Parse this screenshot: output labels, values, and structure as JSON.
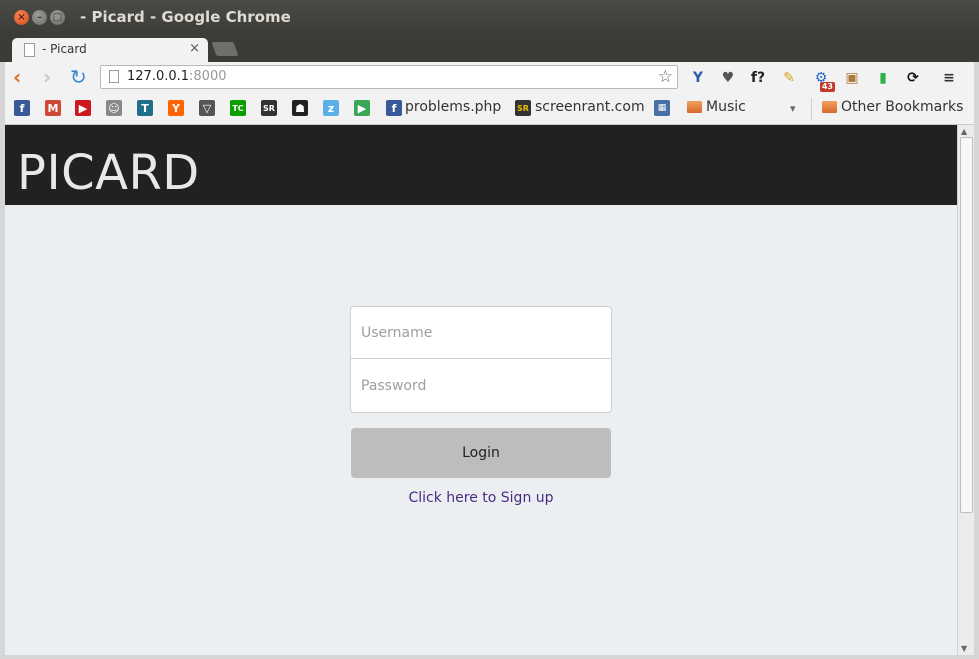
{
  "window": {
    "title": "- Picard - Google Chrome"
  },
  "tab": {
    "title": "- Picard",
    "close_glyph": "×"
  },
  "toolbar": {
    "url_host": "127.0.0.1",
    "url_port": ":8000",
    "star_glyph": "☆",
    "back_glyph": "‹",
    "forward_glyph": "›",
    "reload_glyph": "↻"
  },
  "extensions": [
    {
      "name": "vimium-icon",
      "glyph": "Y",
      "color": "#2b5fa8"
    },
    {
      "name": "pocket-icon",
      "glyph": "♥",
      "color": "#555555"
    },
    {
      "name": "font-finder-icon",
      "glyph": "f?",
      "color": "#222222"
    },
    {
      "name": "notes-icon",
      "glyph": "✎",
      "color": "#d6a21a"
    },
    {
      "name": "settings-gear-icon",
      "glyph": "⚙",
      "color": "#2867c7",
      "badge": "43"
    },
    {
      "name": "evernote-icon",
      "glyph": "▣",
      "color": "#b07a3a"
    },
    {
      "name": "feedly-icon",
      "glyph": "▮",
      "color": "#2bb24c"
    },
    {
      "name": "sync-icon",
      "glyph": "⟳",
      "color": "#111111"
    },
    {
      "name": "menu-icon",
      "glyph": "≡",
      "color": "#333333"
    }
  ],
  "bookmarks": {
    "icons": [
      {
        "name": "facebook-icon",
        "glyph": "f",
        "color": "#3b5998"
      },
      {
        "name": "gmail-icon",
        "glyph": "M",
        "color": "#d14836"
      },
      {
        "name": "youtube-icon",
        "glyph": "▶",
        "color": "#cc181e"
      },
      {
        "name": "reddit-icon",
        "glyph": "☺",
        "color": "#888888"
      },
      {
        "name": "t-icon",
        "glyph": "T",
        "color": "#1f6f8b"
      },
      {
        "name": "hacker-news-icon",
        "glyph": "Y",
        "color": "#ff6600"
      },
      {
        "name": "verge-icon",
        "glyph": "▽",
        "color": "#555555"
      },
      {
        "name": "techcrunch-icon",
        "glyph": "TC",
        "color": "#0a9e01"
      },
      {
        "name": "screenrant-small-icon",
        "glyph": "SR",
        "color": "#333333"
      },
      {
        "name": "robot-icon",
        "glyph": "☗",
        "color": "#222222"
      },
      {
        "name": "z-icon",
        "glyph": "z",
        "color": "#5bb0e8"
      },
      {
        "name": "play-store-icon",
        "glyph": "▶",
        "color": "#3aa757"
      }
    ],
    "problems": "problems.php",
    "screenrant": "screenrant.com",
    "music": "Music",
    "other": "Other Bookmarks",
    "chevron": "▾"
  },
  "app": {
    "brand": "PICARD",
    "username_placeholder": "Username",
    "password_placeholder": "Password",
    "login_label": "Login",
    "signup_label": "Click here to Sign up"
  },
  "colors": {
    "header": "#212121",
    "background": "#eceff1",
    "button": "#bdbdbd",
    "link": "#4b2a86"
  }
}
